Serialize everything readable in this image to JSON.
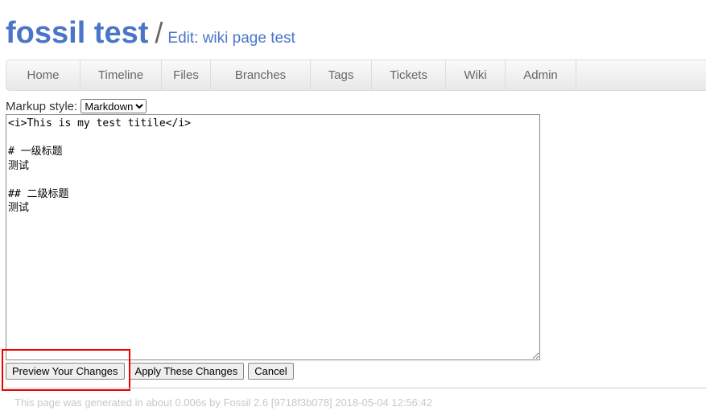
{
  "header": {
    "project": "fossil test",
    "separator": "/",
    "subtitle": "Edit: wiki page test"
  },
  "nav": {
    "items": [
      {
        "label": "Home"
      },
      {
        "label": "Timeline"
      },
      {
        "label": "Files"
      },
      {
        "label": "Branches"
      },
      {
        "label": "Tags"
      },
      {
        "label": "Tickets"
      },
      {
        "label": "Wiki"
      },
      {
        "label": "Admin"
      }
    ]
  },
  "editor": {
    "markup_label": "Markup style:",
    "markup_value": "Markdown",
    "content": "<i>This is my test titile</i>\n\n# 一级标题\n测试\n\n## 二级标题\n测试"
  },
  "buttons": {
    "preview": "Preview Your Changes",
    "apply": "Apply These Changes",
    "cancel": "Cancel"
  },
  "highlight_color": "#e00000",
  "footer": {
    "text": "This page was generated in about 0.006s by Fossil 2.6 [9718f3b078] 2018-05-04 12:56:42"
  }
}
